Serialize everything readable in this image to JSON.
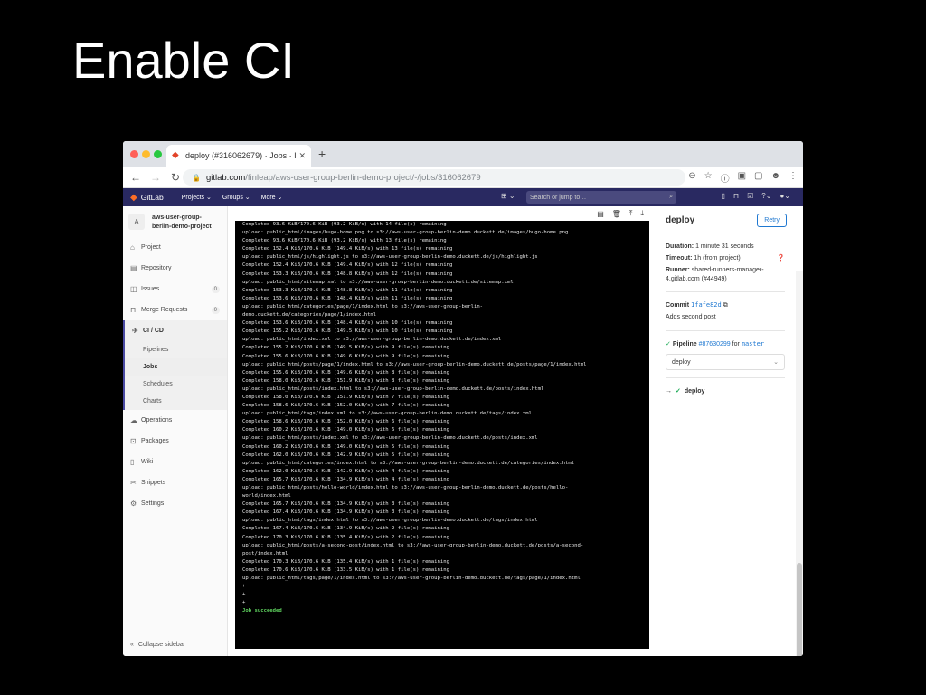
{
  "slide": {
    "title": "Enable CI"
  },
  "browser": {
    "tab_title": "deploy (#316062679) · Jobs · I",
    "url_host": "gitlab.com",
    "url_path": "/finleap/aws-user-group-berlin-demo-project/-/jobs/316062679",
    "new_tab": "+"
  },
  "gitlab": {
    "brand": "GitLab",
    "menu": [
      "Projects ⌄",
      "Groups ⌄",
      "More ⌄"
    ],
    "search_placeholder": "Search or jump to…"
  },
  "sidebar": {
    "avatar_letter": "A",
    "project_name_line1": "aws-user-group-",
    "project_name_line2": "berlin-demo-project",
    "items": [
      {
        "label": "Project",
        "icon": "home-icon"
      },
      {
        "label": "Repository",
        "icon": "doc-icon"
      },
      {
        "label": "Issues",
        "icon": "issues-icon",
        "count": "0"
      },
      {
        "label": "Merge Requests",
        "icon": "merge-icon",
        "count": "0"
      }
    ],
    "cicd_label": "CI / CD",
    "cicd_sub": [
      "Pipelines",
      "Jobs",
      "Schedules",
      "Charts"
    ],
    "items_after": [
      {
        "label": "Operations"
      },
      {
        "label": "Packages"
      },
      {
        "label": "Wiki"
      },
      {
        "label": "Snippets"
      },
      {
        "label": "Settings"
      }
    ],
    "collapse_label": "Collapse sidebar"
  },
  "log": {
    "lines": [
      "Completed 93.6 KiB/170.6 KiB (93.2 KiB/s) with 14 file(s) remaining",
      "upload: public_html/images/hugo-home.png to s3://aws-user-group-berlin-demo.duckett.de/images/hugo-home.png",
      "Completed 93.6 KiB/170.6 KiB (93.2 KiB/s) with 13 file(s) remaining",
      "Completed 152.4 KiB/170.6 KiB (149.4 KiB/s) with 13 file(s) remaining",
      "upload: public_html/js/highlight.js to s3://aws-user-group-berlin-demo.duckett.de/js/highlight.js",
      "Completed 152.4 KiB/170.6 KiB (149.4 KiB/s) with 12 file(s) remaining",
      "Completed 153.3 KiB/170.6 KiB (148.8 KiB/s) with 12 file(s) remaining",
      "upload: public_html/sitemap.xml to s3://aws-user-group-berlin-demo.duckett.de/sitemap.xml",
      "Completed 153.3 KiB/170.6 KiB (148.8 KiB/s) with 11 file(s) remaining",
      "Completed 153.6 KiB/170.6 KiB (148.4 KiB/s) with 11 file(s) remaining",
      "upload: public_html/categories/page/1/index.html to s3://aws-user-group-berlin-",
      "demo.duckett.de/categories/page/1/index.html",
      "Completed 153.6 KiB/170.6 KiB (148.4 KiB/s) with 10 file(s) remaining",
      "Completed 155.2 KiB/170.6 KiB (149.5 KiB/s) with 10 file(s) remaining",
      "upload: public_html/index.xml to s3://aws-user-group-berlin-demo.duckett.de/index.xml",
      "Completed 155.2 KiB/170.6 KiB (149.5 KiB/s) with 9 file(s) remaining",
      "Completed 155.6 KiB/170.6 KiB (149.6 KiB/s) with 9 file(s) remaining",
      "upload: public_html/posts/page/1/index.html to s3://aws-user-group-berlin-demo.duckett.de/posts/page/1/index.html",
      "Completed 155.6 KiB/170.6 KiB (149.6 KiB/s) with 8 file(s) remaining",
      "Completed 158.0 KiB/170.6 KiB (151.9 KiB/s) with 8 file(s) remaining",
      "upload: public_html/posts/index.html to s3://aws-user-group-berlin-demo.duckett.de/posts/index.html",
      "Completed 158.0 KiB/170.6 KiB (151.9 KiB/s) with 7 file(s) remaining",
      "Completed 158.6 KiB/170.6 KiB (152.0 KiB/s) with 7 file(s) remaining",
      "upload: public_html/tags/index.xml to s3://aws-user-group-berlin-demo.duckett.de/tags/index.xml",
      "Completed 158.6 KiB/170.6 KiB (152.0 KiB/s) with 6 file(s) remaining",
      "Completed 160.2 KiB/170.6 KiB (149.0 KiB/s) with 6 file(s) remaining",
      "upload: public_html/posts/index.xml to s3://aws-user-group-berlin-demo.duckett.de/posts/index.xml",
      "Completed 160.2 KiB/170.6 KiB (149.0 KiB/s) with 5 file(s) remaining",
      "Completed 162.0 KiB/170.6 KiB (142.9 KiB/s) with 5 file(s) remaining",
      "upload: public_html/categories/index.html to s3://aws-user-group-berlin-demo.duckett.de/categories/index.html",
      "Completed 162.0 KiB/170.6 KiB (142.9 KiB/s) with 4 file(s) remaining",
      "Completed 165.7 KiB/170.6 KiB (134.9 KiB/s) with 4 file(s) remaining",
      "upload: public_html/posts/hello-world/index.html to s3://aws-user-group-berlin-demo.duckett.de/posts/hello-",
      "world/index.html",
      "Completed 165.7 KiB/170.6 KiB (134.9 KiB/s) with 3 file(s) remaining",
      "Completed 167.4 KiB/170.6 KiB (134.9 KiB/s) with 3 file(s) remaining",
      "upload: public_html/tags/index.html to s3://aws-user-group-berlin-demo.duckett.de/tags/index.html",
      "Completed 167.4 KiB/170.6 KiB (134.9 KiB/s) with 2 file(s) remaining",
      "Completed 170.3 KiB/170.6 KiB (135.4 KiB/s) with 2 file(s) remaining",
      "upload: public_html/posts/a-second-post/index.html to s3://aws-user-group-berlin-demo.duckett.de/posts/a-second-",
      "post/index.html",
      "Completed 170.3 KiB/170.6 KiB (135.4 KiB/s) with 1 file(s) remaining",
      "Completed 170.6 KiB/170.6 KiB (133.5 KiB/s) with 1 file(s) remaining",
      "upload: public_html/tags/page/1/index.html to s3://aws-user-group-berlin-demo.duckett.de/tags/page/1/index.html",
      "+",
      "+",
      "+"
    ],
    "success": "Job succeeded"
  },
  "job": {
    "title": "deploy",
    "retry": "Retry",
    "duration_label": "Duration:",
    "duration": "1 minute 31 seconds",
    "timeout_label": "Timeout:",
    "timeout": "1h (from project)",
    "runner_label": "Runner:",
    "runner": "shared-runners-manager-4.gitlab.com (#44949)",
    "commit_label": "Commit",
    "commit_sha": "1fafe82d",
    "commit_message": "Adds second post",
    "pipeline_label": "Pipeline",
    "pipeline_id": "#87630299",
    "for_text": "for",
    "branch": "master",
    "stage_select": "deploy",
    "job_name": "deploy"
  }
}
